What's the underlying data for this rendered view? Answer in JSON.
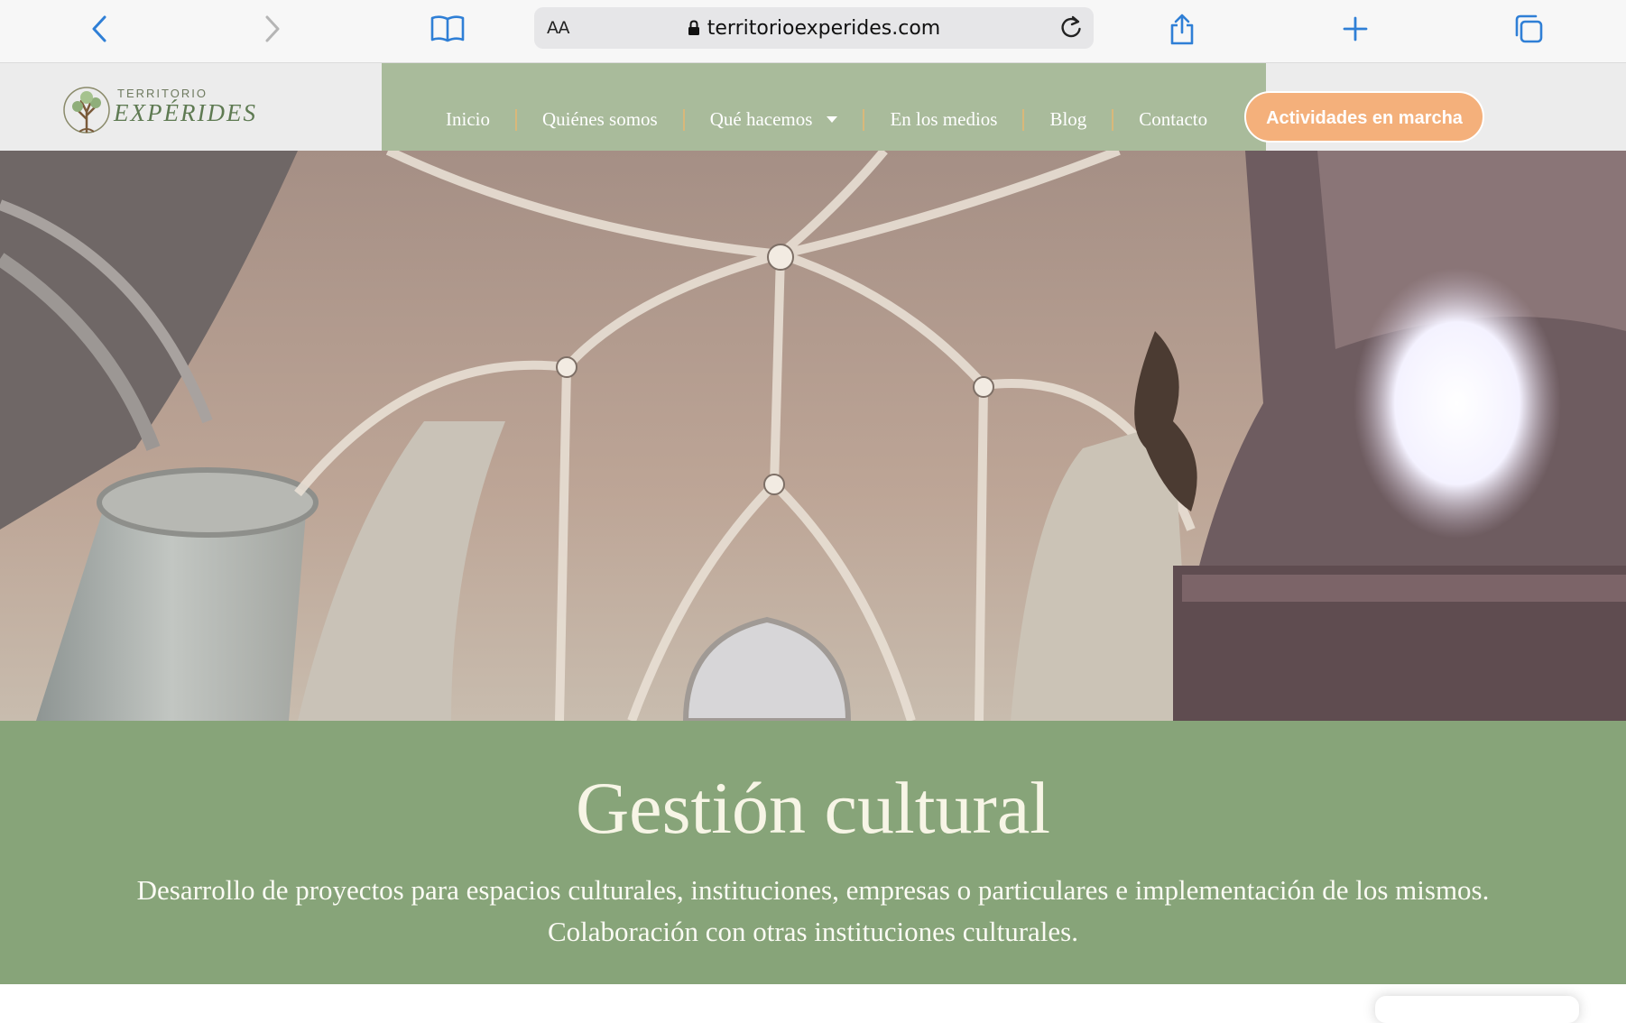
{
  "browser": {
    "aa_label": "AA",
    "url": "territorioexperides.com",
    "icons": [
      "back-icon",
      "forward-icon",
      "bookmarks-icon",
      "lock-icon",
      "reload-icon",
      "share-icon",
      "new-tab-icon",
      "tabs-icon"
    ]
  },
  "site": {
    "logo_top": "TERRITORIO",
    "logo_main": "EXPÉRIDES",
    "nav": [
      {
        "label": "Inicio"
      },
      {
        "label": "Quiénes somos"
      },
      {
        "label": "Qué hacemos",
        "has_dropdown": true
      },
      {
        "label": "En los medios"
      },
      {
        "label": "Blog"
      },
      {
        "label": "Contacto"
      }
    ],
    "cta_label": "Actividades en marcha"
  },
  "band": {
    "title": "Gestión cultural",
    "description": "Desarrollo de proyectos para espacios culturales, instituciones, empresas o particulares e implementación de los mismos. Colaboración con otras instituciones culturales."
  },
  "colors": {
    "nav_bg": "#a9bb9b",
    "band_bg": "#87a479",
    "cta_bg": "#f4b07b",
    "accent_ios": "#2f7fd6"
  }
}
